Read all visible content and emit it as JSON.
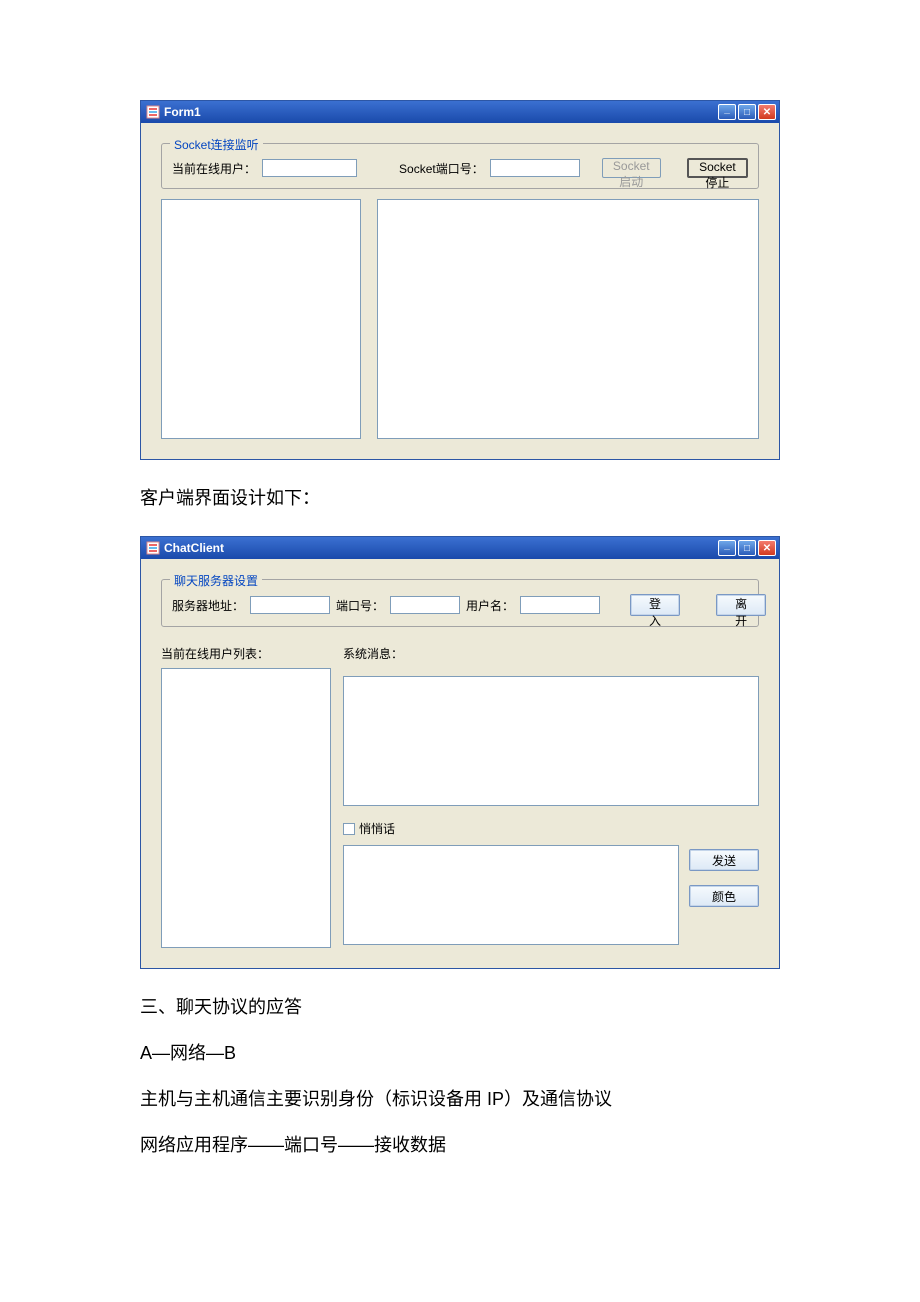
{
  "form1": {
    "title": "Form1",
    "groupTitle": "Socket连接监听",
    "onlineLabel": "当前在线用户：",
    "portLabel": "Socket端口号：",
    "startBtn": "Socket启动",
    "stopBtn": "Socket停止"
  },
  "caption1": "客户端界面设计如下：",
  "client": {
    "title": "ChatClient",
    "groupTitle": "聊天服务器设置",
    "serverAddrLabel": "服务器地址：",
    "portLabel": "端口号：",
    "userLabel": "用户名：",
    "loginBtn": "登入",
    "leaveBtn": "离开",
    "onlineListLabel": "当前在线用户列表：",
    "sysMsgLabel": "系统消息：",
    "whisperLabel": "悄悄话",
    "sendBtn": "发送",
    "colorBtn": "颜色"
  },
  "section3": {
    "heading": "三、聊天协议的应答",
    "line1": "A—网络—B",
    "line2": "主机与主机通信主要识别身份（标识设备用 IP）及通信协议",
    "line3": "网络应用程序——端口号——接收数据"
  }
}
